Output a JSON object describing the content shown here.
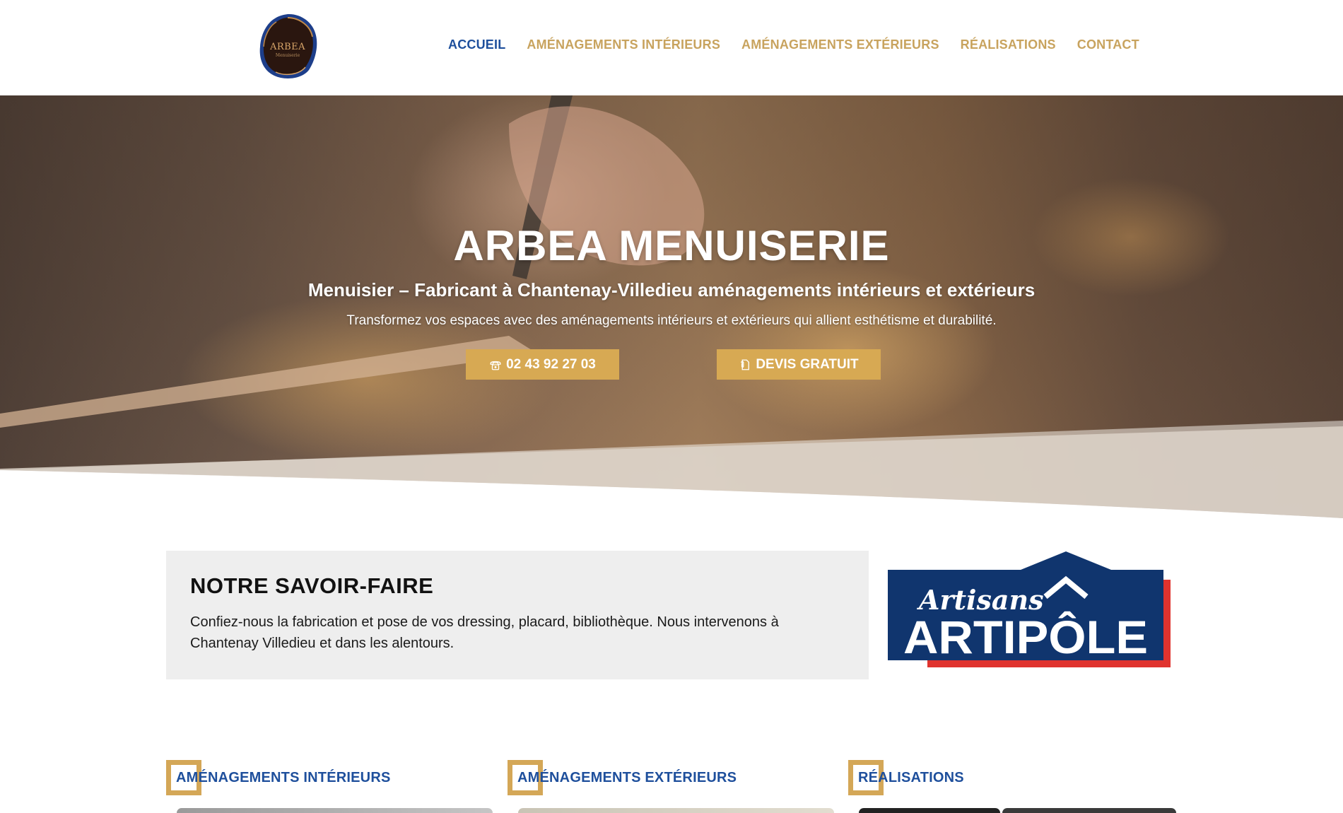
{
  "header": {
    "logo": {
      "title": "ARBEA",
      "subtitle": "Menuiserie"
    },
    "nav": [
      {
        "label": "ACCUEIL",
        "active": true
      },
      {
        "label": "AMÉNAGEMENTS INTÉRIEURS",
        "active": false
      },
      {
        "label": "AMÉNAGEMENTS EXTÉRIEURS",
        "active": false
      },
      {
        "label": "RÉALISATIONS",
        "active": false
      },
      {
        "label": "CONTACT",
        "active": false
      }
    ]
  },
  "hero": {
    "title": "ARBEA MENUISERIE",
    "subtitle": "Menuisier – Fabricant à Chantenay-Villedieu aménagements intérieurs et extérieurs",
    "text": "Transformez vos espaces avec des aménagements intérieurs et extérieurs qui allient esthétisme et durabilité.",
    "phone_button": {
      "label": "02 43 92 27 03",
      "icon": "phone-icon"
    },
    "devis_button": {
      "label": "DEVIS GRATUIT",
      "icon": "document-icon"
    }
  },
  "savoir_faire": {
    "title": "NOTRE SAVOIR-FAIRE",
    "text": "Confiez-nous la fabrication et pose de vos dressing, placard, bibliothèque. Nous intervenons à Chantenay Villedieu et dans les alentours."
  },
  "badge": {
    "line1": "Artisans",
    "line2": "ARTIPÔLE"
  },
  "categories": [
    {
      "label": "AMÉNAGEMENTS INTÉRIEURS"
    },
    {
      "label": "AMÉNAGEMENTS EXTÉRIEURS"
    },
    {
      "label": "RÉALISATIONS"
    }
  ],
  "colors": {
    "brand_blue": "#1e4f9c",
    "gold": "#d7a953",
    "nav_gold": "#c8a35e",
    "panel_grey": "#eeeeee",
    "artipole_navy": "#10356e",
    "artipole_red": "#e0332e"
  }
}
